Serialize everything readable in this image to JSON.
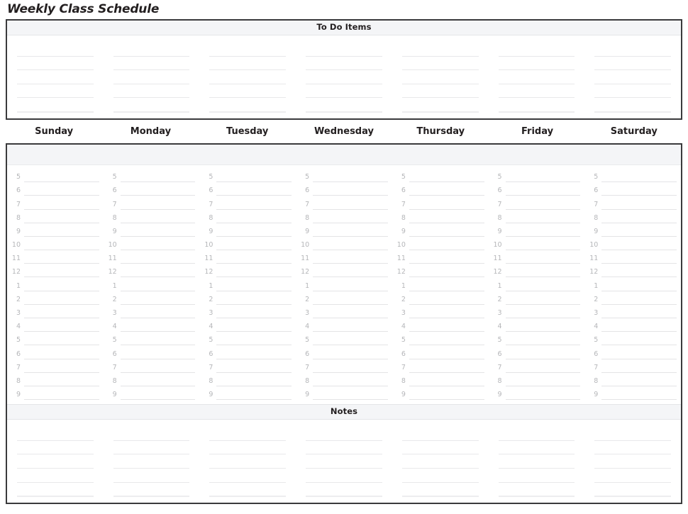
{
  "title": "Weekly Class Schedule",
  "todo": {
    "heading": "To Do Items",
    "line_count": 5
  },
  "days": [
    {
      "label": "Sunday"
    },
    {
      "label": "Monday"
    },
    {
      "label": "Tuesday"
    },
    {
      "label": "Wednesday"
    },
    {
      "label": "Thursday"
    },
    {
      "label": "Friday"
    },
    {
      "label": "Saturday"
    }
  ],
  "schedule": {
    "hours": [
      "5",
      "6",
      "7",
      "8",
      "9",
      "10",
      "11",
      "12",
      "1",
      "2",
      "3",
      "4",
      "5",
      "6",
      "7",
      "8",
      "9"
    ]
  },
  "notes": {
    "heading": "Notes",
    "line_count": 5
  },
  "colors": {
    "border": "#3a3a3c",
    "band_background": "#f4f5f7",
    "rule_line": "#e8e8ea",
    "hour_text": "#b5b6b9",
    "heading_text": "#231f20"
  }
}
